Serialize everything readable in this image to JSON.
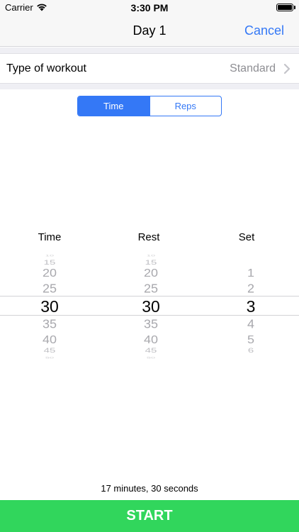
{
  "status_bar": {
    "carrier": "Carrier",
    "time": "3:30 PM",
    "wifi_icon": "wifi-icon",
    "battery_icon": "battery-icon",
    "battery_level": 1.0
  },
  "nav": {
    "title": "Day 1",
    "cancel_label": "Cancel"
  },
  "workout_row": {
    "label": "Type of workout",
    "value": "Standard",
    "chevron_icon": "chevron-right-icon"
  },
  "segmented": {
    "options": [
      "Time",
      "Reps"
    ],
    "selected": "Time"
  },
  "picker": {
    "headers": {
      "time": "Time",
      "rest": "Rest",
      "set": "Set"
    },
    "time": {
      "above": [
        "10",
        "15",
        "20",
        "25"
      ],
      "selected": "30",
      "below": [
        "35",
        "40",
        "45",
        "50"
      ]
    },
    "rest": {
      "above": [
        "10",
        "15",
        "20",
        "25"
      ],
      "selected": "30",
      "below": [
        "35",
        "40",
        "45",
        "50"
      ]
    },
    "set": {
      "above": [
        "1",
        "2"
      ],
      "selected": "3",
      "below": [
        "4",
        "5",
        "6"
      ]
    }
  },
  "summary": "17 minutes, 30 seconds",
  "start_label": "START",
  "colors": {
    "accent": "#3478f6",
    "start_green": "#31d65c",
    "secondary_text": "#8e8e93"
  }
}
